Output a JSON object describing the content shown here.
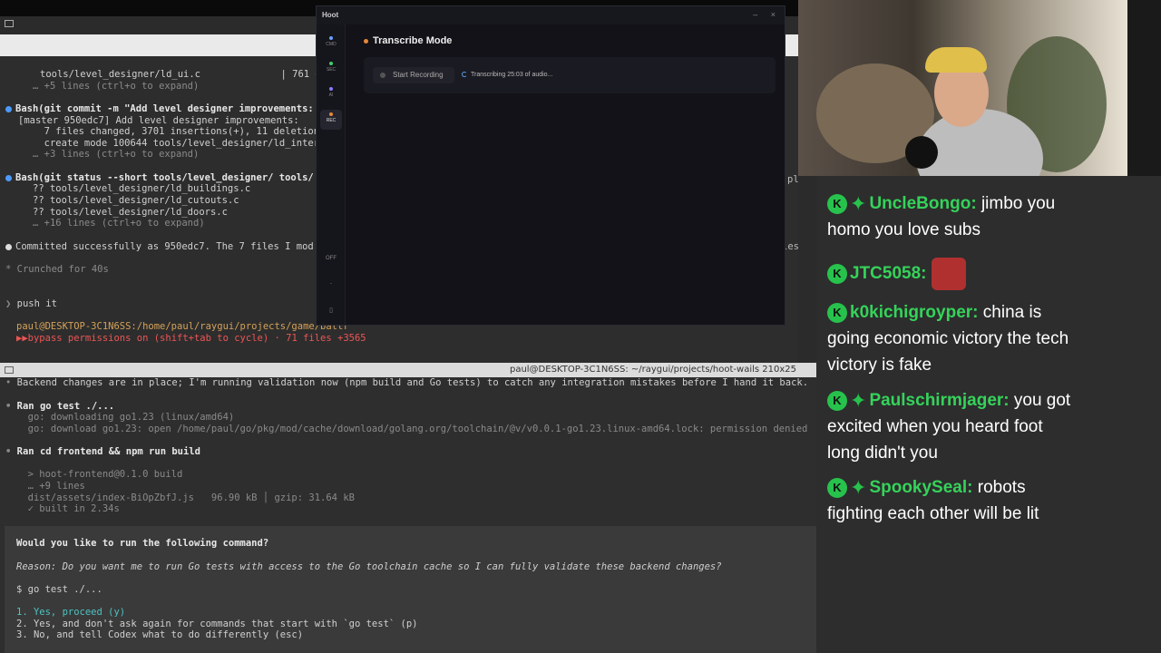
{
  "terminal_top": {
    "title": "",
    "lines": [
      {
        "text": "tools/level_designer/ld_ui.c              | 761 ++"
      },
      {
        "text": "… +5 lines (ctrl+o to expand)"
      },
      {
        "text": "Bash(git commit -m \"Add level designer improvements:"
      },
      {
        "text": "[master 950edc7] Add level designer improvements:"
      },
      {
        "text": "  7 files changed, 3701 insertions(+), 11 deletion"
      },
      {
        "text": "  create mode 100644 tools/level_designer/ld_inter"
      },
      {
        "text": "… +3 lines (ctrl+o to expand)"
      },
      {
        "text": "Bash(git status --short tools/level_designer/ tools/"
      },
      {
        "text": "?? tools/level_designer/ld_buildings.c"
      },
      {
        "text": "?? tools/level_designer/ld_cutouts.c"
      },
      {
        "text": "?? tools/level_designer/ld_doors.c"
      },
      {
        "text": "… +16 lines (ctrl+o to expand)"
      },
      {
        "text": "Committed successfully as 950edc7. The 7 files I mod"
      },
      {
        "text": "Crunched for 40s"
      },
      {
        "text": "push it"
      },
      {
        "text": "paul@DESKTOP-3C1N6SS:/home/paul/raygui/projects/game/battr"
      },
      {
        "text": "bypass permissions on (shift+tab to cycle) · 71 files +3565"
      }
    ],
    "right_overflow_1": "plate_designer/ld_internal.h too…)",
    "right_overflow_2": "les that were already there before this session."
  },
  "divider_title": "paul@DESKTOP-3C1N6SS: ~/raygui/projects/hoot-wails 210x25",
  "terminal_bottom": {
    "lines": [
      {
        "text": "Backend changes are in place; I'm running validation now (npm build and Go tests) to catch any integration mistakes before I hand it back."
      },
      {
        "text": "Ran go test ./..."
      },
      {
        "text": "  go: downloading go1.23 (linux/amd64)"
      },
      {
        "text": "  go: download go1.23: open /home/paul/go/pkg/mod/cache/download/golang.org/toolchain/@v/v0.0.1-go1.23.linux-amd64.lock: permission denied"
      },
      {
        "text": "Ran cd frontend && npm run build"
      },
      {
        "text": "  > hoot-frontend@0.1.0 build"
      },
      {
        "text": "  … +9 lines"
      },
      {
        "text": "  dist/assets/index-BiOpZbfJ.js   96.90 kB │ gzip: 31.64 kB"
      },
      {
        "text": "  ✓ built in 2.34s"
      }
    ],
    "prompt": {
      "question": "Would you like to run the following command?",
      "reason": "Reason: Do you want me to run Go tests with access to the Go toolchain cache so I can fully validate these backend changes?",
      "command": "$ go test ./...",
      "options": [
        "1. Yes, proceed (y)",
        "2. Yes, and don't ask again for commands that start with `go test` (p)",
        "3. No, and tell Codex what to do differently (esc)"
      ]
    }
  },
  "hoot": {
    "title": "Hoot",
    "controls": {
      "minimize": "–",
      "close": "×"
    },
    "sidebar": [
      {
        "label": "CMD",
        "color": "#6aa0ff"
      },
      {
        "label": "SEC",
        "color": "#3ecf6a"
      },
      {
        "label": "AI",
        "color": "#8a7cff"
      },
      {
        "label": "REC",
        "color": "#e8873a"
      }
    ],
    "sidebar_bottom": {
      "off": "OFF",
      "dot": "·",
      "tiny": "▯"
    },
    "mode_title": "Transcribe Mode",
    "start_button": "Start Recording",
    "status": "Transcribing 25:03 of audio..."
  },
  "chat": {
    "messages": [
      {
        "user": "UncleBongo:",
        "text": "jimbo you homo you love subs",
        "star": true
      },
      {
        "user": "JTC5058:",
        "text": "",
        "star": false,
        "emote": true
      },
      {
        "user": "k0kichigroyper:",
        "text": "china is going economic victory the tech victory is fake",
        "star": false
      },
      {
        "user": "Paulschirmjager:",
        "text": "you got excited when you heard foot long didn't you",
        "star": true
      },
      {
        "user": "SpookySeal:",
        "text": "robots fighting each other will be lit",
        "star": true
      }
    ],
    "badge_letter": "K",
    "star_glyph": "✦"
  }
}
